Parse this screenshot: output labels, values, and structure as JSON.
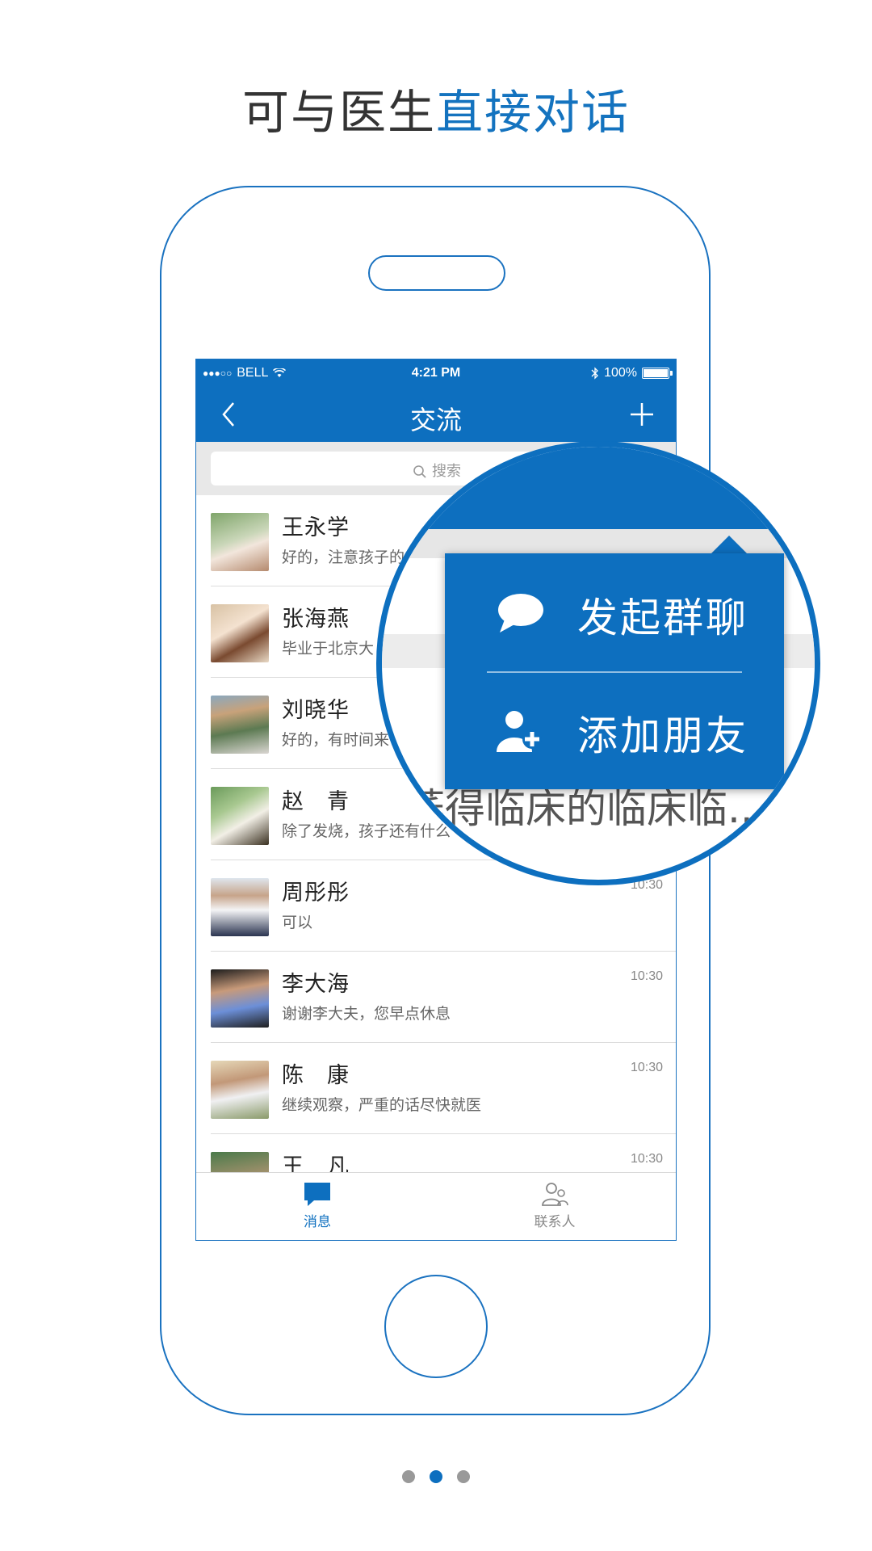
{
  "headline": {
    "plain": "可与医生",
    "accent": "直接对话"
  },
  "statusbar": {
    "carrier": "BELL",
    "time": "4:21 PM",
    "battery": "100%"
  },
  "navbar": {
    "title": "交流"
  },
  "search": {
    "placeholder": "搜索"
  },
  "conversations": [
    {
      "name": "王永学",
      "message": "好的，注意孩子的",
      "time": ""
    },
    {
      "name": "张海燕",
      "message": "毕业于北京大",
      "time": ""
    },
    {
      "name": "刘晓华",
      "message": "好的，有时间来",
      "time": ""
    },
    {
      "name": "赵　青",
      "message": "除了发烧，孩子还有什么",
      "time": ""
    },
    {
      "name": "周彤彤",
      "message": "可以",
      "time": "10:30"
    },
    {
      "name": "李大海",
      "message": "谢谢李大夫，您早点休息",
      "time": "10:30"
    },
    {
      "name": "陈　康",
      "message": "继续观察，严重的话尽快就医",
      "time": "10:30"
    },
    {
      "name": "王　凡",
      "message": "",
      "time": "10:30"
    }
  ],
  "popup_menu": {
    "items": [
      {
        "label": "发起群聊",
        "icon": "chat-bubble-icon"
      },
      {
        "label": "添加朋友",
        "icon": "add-friend-icon"
      }
    ],
    "background_text": "荞得临床的临床临..."
  },
  "tabbar": {
    "tabs": [
      {
        "label": "消息",
        "icon": "message-icon",
        "active": true
      },
      {
        "label": "联系人",
        "icon": "contacts-icon",
        "active": false
      }
    ]
  },
  "pager": {
    "total": 3,
    "active": 2
  },
  "colors": {
    "accent": "#0d6fbf",
    "headline_accent": "#1473bf",
    "outline": "#1a72c0"
  }
}
